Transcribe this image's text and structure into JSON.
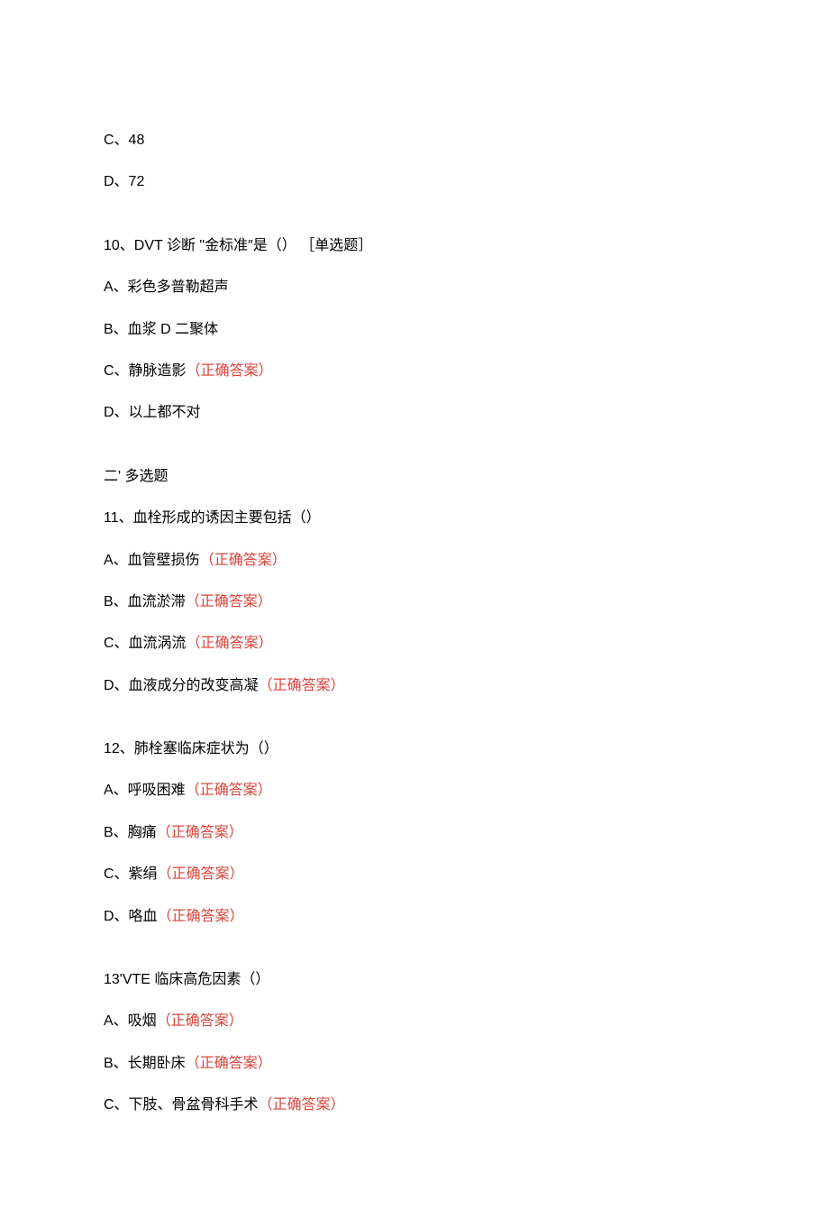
{
  "q9": {
    "optC": "C、48",
    "optD": "D、72"
  },
  "q10": {
    "stem": "10、DVT 诊断 \"金标准″是（） ［单选题］",
    "optA": "A、彩色多普勒超声",
    "optB": "B、血浆 D 二聚体",
    "optC_prefix": "C、静脉造影",
    "optC_correct": "（正确答案）",
    "optD": "D、以上都不对"
  },
  "section2": "二' 多选题",
  "q11": {
    "stem": "11、血栓形成的诱因主要包括（）",
    "optA_prefix": "A、血管壁损伤",
    "optA_correct": "（正确答案）",
    "optB_prefix": "B、血流淤滞",
    "optB_correct": "（正确答案）",
    "optC_prefix": "C、血流涡流",
    "optC_correct": "（正确答案）",
    "optD_prefix": "D、血液成分的改变高凝",
    "optD_correct": "（正确答案）"
  },
  "q12": {
    "stem": "12、肺栓塞临床症状为（）",
    "optA_prefix": "A、呼吸困难",
    "optA_correct": "（正确答案）",
    "optB_prefix": "B、胸痛",
    "optB_correct": "（正确答案）",
    "optC_prefix": "C、紫绢",
    "optC_correct": "（正确答案）",
    "optD_prefix": "D、咯血",
    "optD_correct": "（正确答案）"
  },
  "q13": {
    "stem": "13'VTE 临床高危因素（）",
    "optA_prefix": "A、吸烟",
    "optA_correct": "（正确答案）",
    "optB_prefix": "B、长期卧床",
    "optB_correct": "（正确答案）",
    "optC_prefix": "C、下肢、骨盆骨科手术",
    "optC_correct": "（正确答案）"
  }
}
